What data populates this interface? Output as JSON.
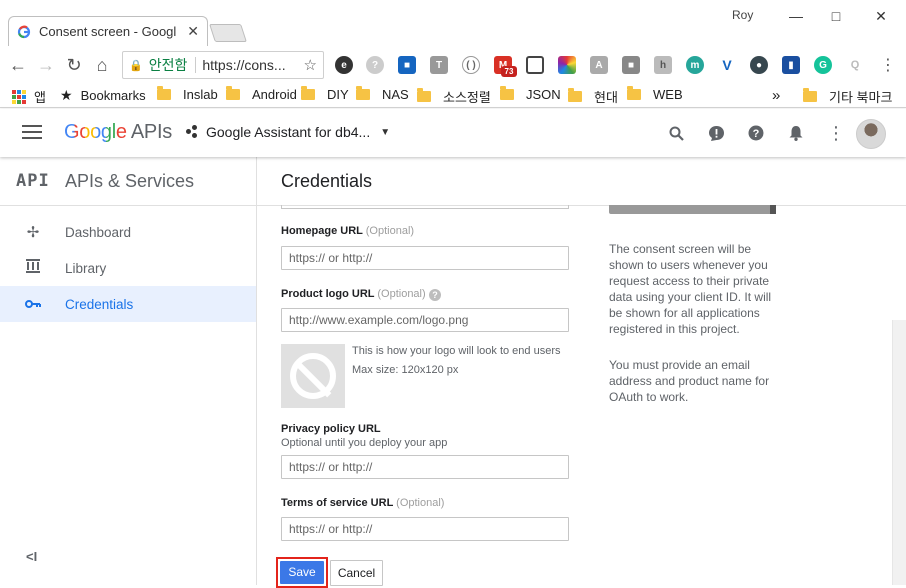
{
  "browser": {
    "tab_title": "Consent screen - Googl",
    "user": "Roy",
    "secure_label": "안전함",
    "url": "https://cons...",
    "gmail_badge": "73"
  },
  "bookmarks": {
    "apps_label": "앱",
    "items": [
      "Bookmarks",
      "Inslab",
      "Android",
      "DIY",
      "NAS",
      "소스정렬",
      "JSON",
      "현대",
      "WEB"
    ],
    "overflow": "»",
    "other": "기타 북마크"
  },
  "header": {
    "logo_google": "Google",
    "logo_apis": "APIs",
    "project": "Google Assistant for db4..."
  },
  "nav": {
    "api_badge": "API",
    "title": "APIs & Services",
    "items": [
      {
        "label": "Dashboard",
        "icon": "dashboard-icon"
      },
      {
        "label": "Library",
        "icon": "library-icon"
      },
      {
        "label": "Credentials",
        "icon": "key-icon",
        "active": true
      }
    ],
    "collapse": "<I"
  },
  "page": {
    "title": "Credentials",
    "homepage": {
      "label": "Homepage URL",
      "optional": "(Optional)",
      "placeholder": "https:// or http://"
    },
    "logo": {
      "label": "Product logo URL",
      "optional": "(Optional)",
      "placeholder": "http://www.example.com/logo.png",
      "hint1": "This is how your logo will look to end users",
      "hint2": "Max size: 120x120 px"
    },
    "privacy": {
      "label": "Privacy policy URL",
      "sub": "Optional until you deploy your app",
      "placeholder": "https:// or http://"
    },
    "tos": {
      "label": "Terms of service URL",
      "optional": "(Optional)",
      "placeholder": "https:// or http://"
    },
    "save": "Save",
    "cancel": "Cancel",
    "side_text_1": "The consent screen will be shown to users whenever you request access to their private data using your client ID. It will be shown for all applications registered in this project.",
    "side_text_2": "You must provide an email address and product name for OAuth to work."
  },
  "colors": {
    "accent": "#1a73e8",
    "save_button": "#3b78e7",
    "highlight_border": "#e3241b",
    "secure_green": "#0b8043"
  }
}
